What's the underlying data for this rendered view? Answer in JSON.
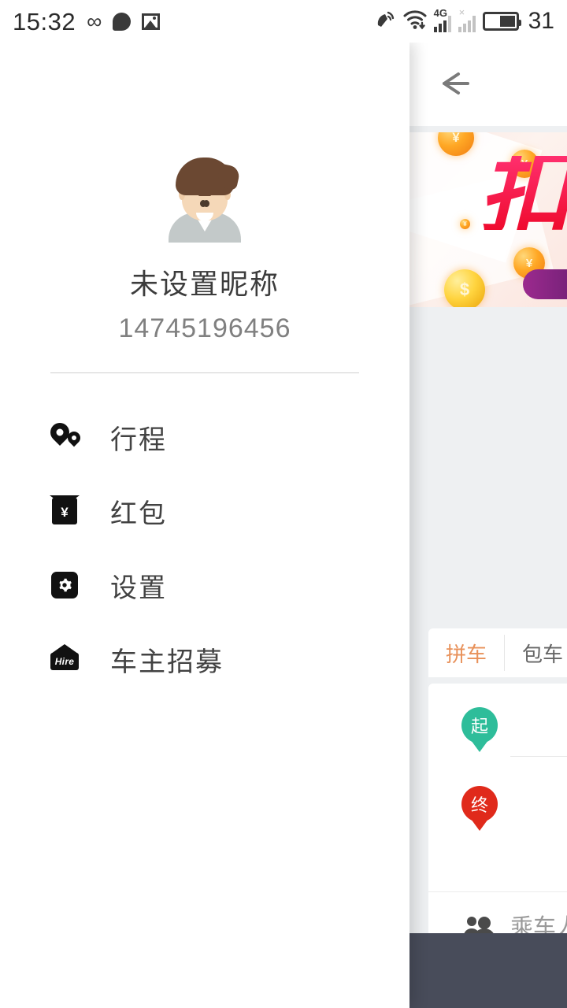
{
  "status_bar": {
    "time": "15:32",
    "battery_percent": "31",
    "network_label": "4G",
    "icons": [
      "infinity-icon",
      "chat-bubble-icon",
      "image-icon",
      "satellite-icon",
      "wifi-icon",
      "signal-bars-icon",
      "signal-bars-muted-icon",
      "battery-icon"
    ]
  },
  "drawer": {
    "profile": {
      "nickname": "未设置昵称",
      "phone": "14745196456",
      "avatar_alt": "default-user-avatar"
    },
    "menu": [
      {
        "label": "行程",
        "icon": "route-pin-icon"
      },
      {
        "label": "红包",
        "icon": "red-packet-icon"
      },
      {
        "label": "设置",
        "icon": "gear-icon"
      },
      {
        "label": "车主招募",
        "icon": "hire-sign-icon"
      }
    ]
  },
  "background_app": {
    "back_icon": "back-arrow-icon",
    "banner": {
      "promo_text": "扣",
      "coin_symbols": [
        "¥",
        "¥",
        "$",
        "¥"
      ],
      "alt": "red-packet-coins-promo-banner"
    },
    "tabs": [
      {
        "label": "拼车",
        "active": true
      },
      {
        "label": "包车",
        "active": false
      }
    ],
    "form": {
      "start_pin_label": "起",
      "end_pin_label": "终",
      "start_placeholder": "",
      "end_placeholder": "",
      "passenger_label": "乘车人数",
      "passenger_icon": "people-icon"
    }
  },
  "colors": {
    "accent_orange": "#e8915a",
    "start_pin_green": "#2ebd9a",
    "end_pin_red": "#e02a1b",
    "drawer_bg": "#ffffff",
    "app_bg": "#eef0f2",
    "bottom_bar": "#484c5a",
    "promo_pink": "#f5115c"
  }
}
